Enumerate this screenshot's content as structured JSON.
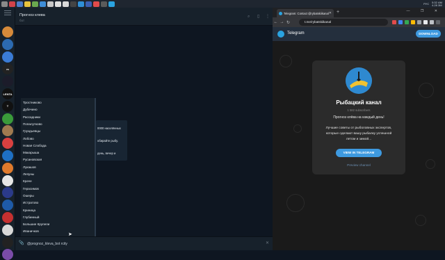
{
  "taskbar": {
    "icons": [
      "#8a8a8a",
      "#d2434a",
      "#4d7cc8",
      "#e8c33c",
      "#6aa84f",
      "#3f8ed8",
      "#c8c8c8",
      "#e0e0e0",
      "#d9d9d9",
      "#444444",
      "#2f8fd6",
      "#3b5fb2",
      "#e24b4b",
      "#5b5b5b",
      "#2aa3e0"
    ],
    "clock_time": "5:32 АМ",
    "clock_date": "4.28 3М",
    "lang": "РУС"
  },
  "telegram": {
    "chat_title": "Прогноз клева",
    "chat_subtitle": "бот",
    "win_controls": "— ❐ ✕",
    "avatars": [
      {
        "label": "",
        "color": "#d68a3a"
      },
      {
        "label": "",
        "color": "#2c6ab0"
      },
      {
        "label": "",
        "color": "#3a7bd5"
      },
      {
        "label": "m",
        "color": "#222222"
      },
      {
        "label": "",
        "color": "#1c1c2a"
      },
      {
        "label": "LENTA",
        "color": "#111111"
      },
      {
        "label": "T",
        "color": "#111111"
      },
      {
        "label": "",
        "color": "#3a9a3a"
      },
      {
        "label": "",
        "color": "#a07a50"
      },
      {
        "label": "",
        "color": "#d94040"
      },
      {
        "label": "",
        "color": "#1e6fc4"
      },
      {
        "label": "",
        "color": "#e07a2c"
      },
      {
        "label": "",
        "color": "#e6e6e6"
      },
      {
        "label": "",
        "color": "#2b3a8a"
      },
      {
        "label": "",
        "color": "#1e5aa8"
      },
      {
        "label": "",
        "color": "#c43030"
      },
      {
        "label": "",
        "color": "#d9d9d9"
      },
      {
        "label": "",
        "color": "#222222"
      },
      {
        "label": "",
        "color": "#7a4ca8"
      }
    ],
    "bubble_lines": [
      "0000 населённых",
      "обирайте рыбу.",
      "день, вечер и"
    ],
    "dropdown_items": [
      "Тростниково",
      "Дубечино",
      "Рассадники",
      "Попалутково",
      "Груздьевцы",
      "Лобово",
      "Новая Слобода",
      "Макарыша",
      "Русановская",
      "Лукашов",
      "Лепуны",
      "Краче",
      "Герасимов",
      "Ошеры",
      "Истратово",
      "Криница",
      "Глубинный",
      "Большие Крупели",
      "Иваничков",
      "Пох"
    ],
    "input_text": "@prognoz_kleva_bot rcity"
  },
  "browser": {
    "tab_title": "Telegram: Contact @rybatskiikanal",
    "win_controls": "— ❐ ✕",
    "url": "t.me/rybatskiikanal",
    "ext_icons": [
      "#e24b4b",
      "#4285f4",
      "#34a853",
      "#fbbc05",
      "#9aa0a6",
      "#e8eaed",
      "#bdc1c6",
      "#5f6368"
    ],
    "tg_name": "Telegram",
    "download_label": "DOWNLOAD",
    "channel_name": "Рыбацкий канал",
    "channel_subs": "1 582 subscribers",
    "channel_desc_title": "Прогноз клёва на каждый день!",
    "channel_desc": [
      "Лучшие советы от рыболовных экспертов,",
      "которые сделают вашу рыбалку успешной",
      "летом и зимой..."
    ],
    "view_button": "VIEW IN TELEGRAM",
    "preview_link": "Preview channel"
  }
}
